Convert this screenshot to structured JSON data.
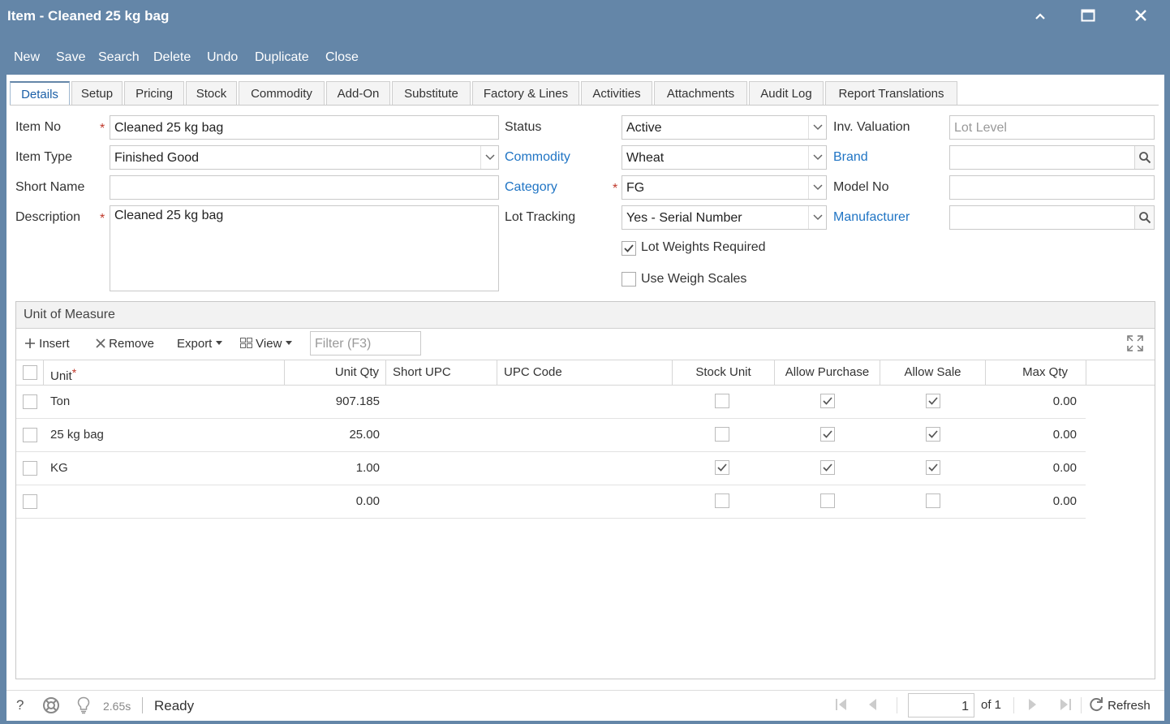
{
  "window": {
    "title": "Item - Cleaned 25 kg bag"
  },
  "toolbar": {
    "new": "New",
    "save": "Save",
    "search": "Search",
    "delete": "Delete",
    "undo": "Undo",
    "duplicate": "Duplicate",
    "close": "Close"
  },
  "tabs": [
    "Details",
    "Setup",
    "Pricing",
    "Stock",
    "Commodity",
    "Add-On",
    "Substitute",
    "Factory & Lines",
    "Activities",
    "Attachments",
    "Audit Log",
    "Report Translations"
  ],
  "form": {
    "item_no": {
      "label": "Item No",
      "value": "Cleaned 25 kg bag"
    },
    "item_type": {
      "label": "Item Type",
      "value": "Finished Good"
    },
    "short_name": {
      "label": "Short Name",
      "value": ""
    },
    "description": {
      "label": "Description",
      "value": "Cleaned 25 kg bag"
    },
    "status": {
      "label": "Status",
      "value": "Active"
    },
    "commodity": {
      "label": "Commodity",
      "value": "Wheat"
    },
    "category": {
      "label": "Category",
      "value": "FG"
    },
    "lot_tracking": {
      "label": "Lot Tracking",
      "value": "Yes - Serial Number"
    },
    "lot_weights_required": {
      "label": "Lot Weights Required",
      "checked": true
    },
    "use_weigh_scales": {
      "label": "Use Weigh Scales",
      "checked": false
    },
    "inv_valuation": {
      "label": "Inv. Valuation",
      "placeholder": "Lot Level"
    },
    "brand": {
      "label": "Brand",
      "value": ""
    },
    "model_no": {
      "label": "Model No",
      "value": ""
    },
    "manufacturer": {
      "label": "Manufacturer",
      "value": ""
    }
  },
  "uom": {
    "title": "Unit of Measure",
    "toolbar": {
      "insert": "Insert",
      "remove": "Remove",
      "export": "Export",
      "view": "View",
      "filter_placeholder": "Filter (F3)"
    },
    "columns": [
      "Unit",
      "Unit Qty",
      "Short UPC",
      "UPC Code",
      "Stock Unit",
      "Allow Purchase",
      "Allow Sale",
      "Max Qty"
    ],
    "rows": [
      {
        "unit": "Ton",
        "unit_qty": "907.185",
        "short_upc": "",
        "upc_code": "",
        "stock_unit": false,
        "allow_purchase": true,
        "allow_sale": true,
        "max_qty": "0.00"
      },
      {
        "unit": "25 kg bag",
        "unit_qty": "25.00",
        "short_upc": "",
        "upc_code": "",
        "stock_unit": false,
        "allow_purchase": true,
        "allow_sale": true,
        "max_qty": "0.00"
      },
      {
        "unit": "KG",
        "unit_qty": "1.00",
        "short_upc": "",
        "upc_code": "",
        "stock_unit": true,
        "allow_purchase": true,
        "allow_sale": true,
        "max_qty": "0.00"
      },
      {
        "unit": "",
        "unit_qty": "0.00",
        "short_upc": "",
        "upc_code": "",
        "stock_unit": false,
        "allow_purchase": false,
        "allow_sale": false,
        "max_qty": "0.00"
      }
    ]
  },
  "status_bar": {
    "help": "?",
    "timing": "2.65s",
    "status": "Ready",
    "page": "1",
    "of_pages": "of 1",
    "refresh": "Refresh"
  },
  "colors": {
    "titlebar": "#6486a8",
    "link": "#1f74c4",
    "required": "#c0392b"
  }
}
